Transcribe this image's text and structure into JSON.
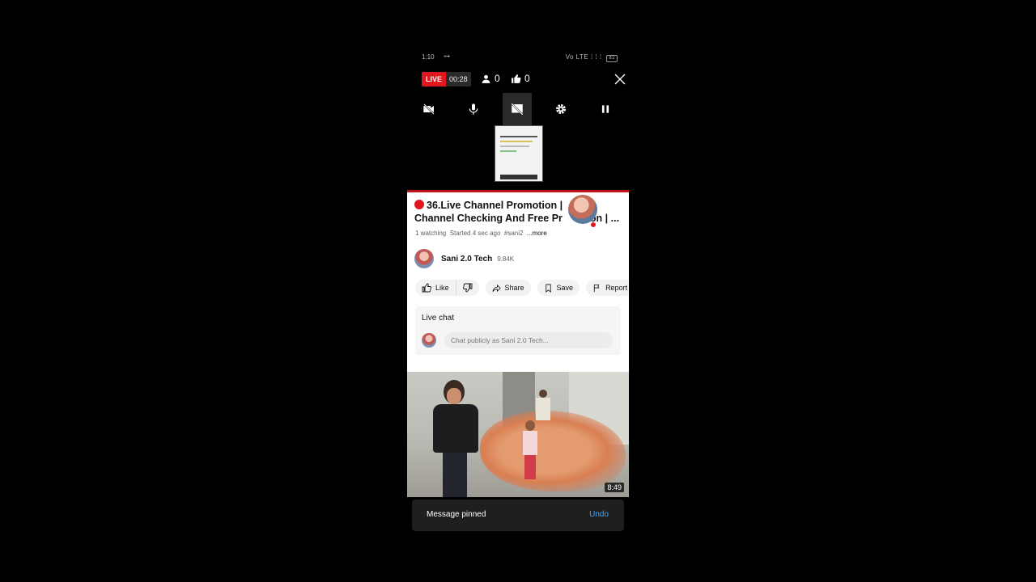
{
  "status_bar": {
    "time": "1:10",
    "glyph": "⊶",
    "signal": "Vo LTE ⁞ ⁞ ⁞",
    "battery": "82"
  },
  "live_toolbar": {
    "live_label": "LIVE",
    "timer": "00:28",
    "viewer_count": "0",
    "like_count": "0",
    "icons": [
      "person-icon",
      "thumbs-up-icon",
      "close-icon",
      "camera-off-icon",
      "microphone-icon",
      "screen-share-off-icon",
      "gear-icon",
      "pause-icon"
    ]
  },
  "video": {
    "title_line1": "36.Live Channel Promotion |",
    "title_line2": "Channel Checking And Free Pr",
    "title_line2_tail": "on | ...",
    "watching": "1 watching",
    "started": "Started 4 sec ago",
    "hashtag": "#sani2",
    "more": "...more"
  },
  "channel": {
    "name": "Sani 2.0 Tech",
    "subscribers": "9.84K"
  },
  "actions": {
    "like": "Like",
    "share": "Share",
    "save": "Save",
    "report": "Report"
  },
  "live_chat": {
    "label": "Live chat",
    "placeholder": "Chat publicly as Sani 2.0 Tech..."
  },
  "thumbnail": {
    "duration": "8:49"
  },
  "toast": {
    "message": "Message pinned",
    "undo": "Undo"
  },
  "colors": {
    "live_red": "#e0171f",
    "link_blue": "#3ea6ff",
    "background": "#000000"
  }
}
